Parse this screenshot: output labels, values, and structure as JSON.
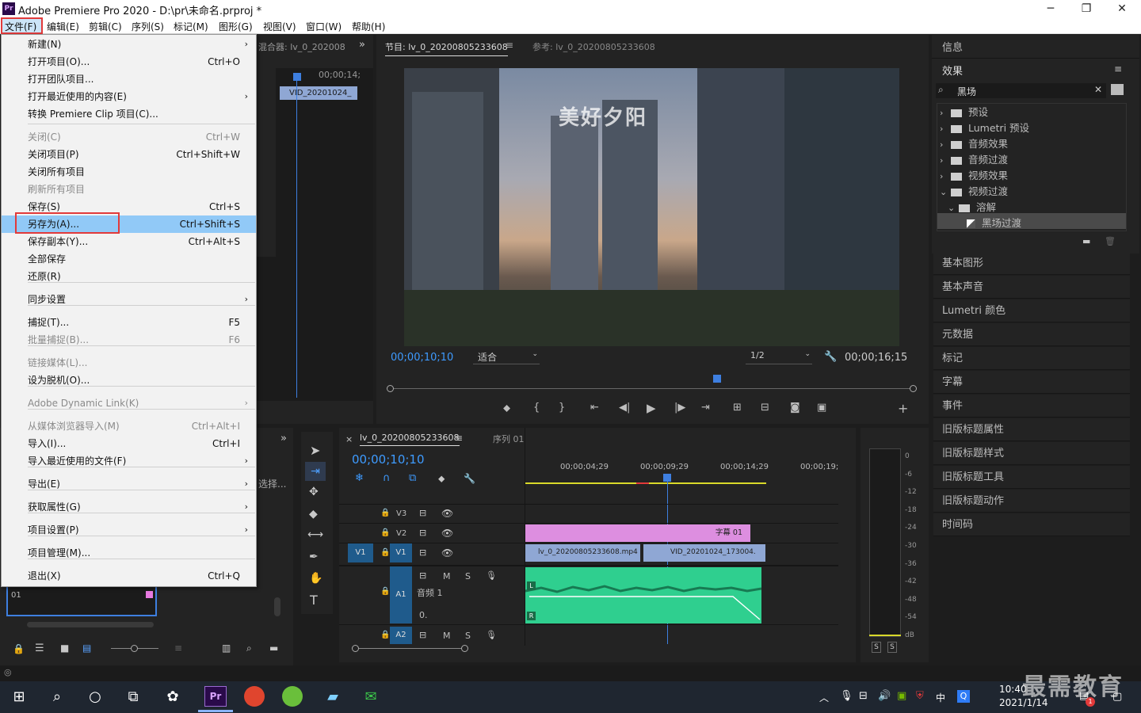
{
  "app": {
    "title": "Adobe Premiere Pro 2020 - D:\\pr\\未命名.prproj *",
    "icon_label": "Pr",
    "minimize": "─",
    "maximize": "❐",
    "close": "✕"
  },
  "menubar": [
    "文件(F)",
    "编辑(E)",
    "剪辑(C)",
    "序列(S)",
    "标记(M)",
    "图形(G)",
    "视图(V)",
    "窗口(W)",
    "帮助(H)"
  ],
  "file_menu": [
    {
      "label": "新建(N)",
      "shortcut": "",
      "arrow": "›",
      "disabled": false
    },
    {
      "label": "打开项目(O)...",
      "shortcut": "Ctrl+O",
      "arrow": "",
      "disabled": false
    },
    {
      "label": "打开团队项目...",
      "shortcut": "",
      "arrow": "",
      "disabled": false
    },
    {
      "label": "打开最近使用的内容(E)",
      "shortcut": "",
      "arrow": "›",
      "disabled": false
    },
    {
      "label": "转换 Premiere Clip 项目(C)...",
      "shortcut": "",
      "arrow": "",
      "disabled": false
    },
    {
      "label": "关闭(C)",
      "shortcut": "Ctrl+W",
      "arrow": "",
      "disabled": true
    },
    {
      "label": "关闭项目(P)",
      "shortcut": "Ctrl+Shift+W",
      "arrow": "",
      "disabled": false
    },
    {
      "label": "关闭所有项目",
      "shortcut": "",
      "arrow": "",
      "disabled": false
    },
    {
      "label": "刷新所有项目",
      "shortcut": "",
      "arrow": "",
      "disabled": true
    },
    {
      "label": "保存(S)",
      "shortcut": "Ctrl+S",
      "arrow": "",
      "disabled": false
    },
    {
      "label": "另存为(A)...",
      "shortcut": "Ctrl+Shift+S",
      "arrow": "",
      "disabled": false
    },
    {
      "label": "保存副本(Y)...",
      "shortcut": "Ctrl+Alt+S",
      "arrow": "",
      "disabled": false
    },
    {
      "label": "全部保存",
      "shortcut": "",
      "arrow": "",
      "disabled": false
    },
    {
      "label": "还原(R)",
      "shortcut": "",
      "arrow": "",
      "disabled": false
    },
    {
      "label": "同步设置",
      "shortcut": "",
      "arrow": "›",
      "disabled": false
    },
    {
      "label": "捕捉(T)...",
      "shortcut": "F5",
      "arrow": "",
      "disabled": false
    },
    {
      "label": "批量捕捉(B)...",
      "shortcut": "F6",
      "arrow": "",
      "disabled": true
    },
    {
      "label": "链接媒体(L)...",
      "shortcut": "",
      "arrow": "",
      "disabled": true
    },
    {
      "label": "设为脱机(O)...",
      "shortcut": "",
      "arrow": "",
      "disabled": false
    },
    {
      "label": "Adobe Dynamic Link(K)",
      "shortcut": "",
      "arrow": "›",
      "disabled": true
    },
    {
      "label": "从媒体浏览器导入(M)",
      "shortcut": "Ctrl+Alt+I",
      "arrow": "",
      "disabled": true
    },
    {
      "label": "导入(I)...",
      "shortcut": "Ctrl+I",
      "arrow": "",
      "disabled": false
    },
    {
      "label": "导入最近使用的文件(F)",
      "shortcut": "",
      "arrow": "›",
      "disabled": false
    },
    {
      "label": "导出(E)",
      "shortcut": "",
      "arrow": "›",
      "disabled": false
    },
    {
      "label": "获取属性(G)",
      "shortcut": "",
      "arrow": "›",
      "disabled": false
    },
    {
      "label": "项目设置(P)",
      "shortcut": "",
      "arrow": "›",
      "disabled": false
    },
    {
      "label": "项目管理(M)...",
      "shortcut": "",
      "arrow": "",
      "disabled": false
    },
    {
      "label": "退出(X)",
      "shortcut": "Ctrl+Q",
      "arrow": "",
      "disabled": false
    }
  ],
  "source_panel": {
    "tab": "混合器: lv_0_202008",
    "timecode": "00;00;14;",
    "clip": "VID_20201024_",
    "more": "»"
  },
  "program": {
    "tab": "节目: lv_0_20200805233608",
    "ref_tab": "参考: lv_0_20200805233608",
    "timecode_left": "00;00;10;10",
    "fit": "适合",
    "quality": "1/2",
    "timecode_right": "00;00;16;15",
    "caption": "美好夕阳"
  },
  "effects": {
    "info_tab": "信息",
    "tab": "效果",
    "search": "黑场",
    "tree": [
      {
        "label": "预设",
        "level": 0,
        "open": false
      },
      {
        "label": "Lumetri 预设",
        "level": 0,
        "open": false
      },
      {
        "label": "音频效果",
        "level": 0,
        "open": false
      },
      {
        "label": "音频过渡",
        "level": 0,
        "open": false
      },
      {
        "label": "视频效果",
        "level": 0,
        "open": false
      },
      {
        "label": "视频过渡",
        "level": 0,
        "open": true
      },
      {
        "label": "溶解",
        "level": 1,
        "open": true
      },
      {
        "label": "黑场过渡",
        "level": 2,
        "open": false
      }
    ]
  },
  "right_items": [
    "基本图形",
    "基本声音",
    "Lumetri 颜色",
    "元数据",
    "标记",
    "字幕",
    "事件",
    "旧版标题属性",
    "旧版标题样式",
    "旧版标题工具",
    "旧版标题动作",
    "时间码"
  ],
  "timeline": {
    "close": "×",
    "tab": "lv_0_20200805233608",
    "tab2": "序列 01",
    "timecode": "00;00;10;10",
    "ruler": [
      "00;00;04;29",
      "00;00;09;29",
      "00;00;14;29",
      "00;00;19;"
    ],
    "tracks": [
      "V3",
      "V2",
      "V1",
      "A1",
      "A2"
    ],
    "src_v1": "V1",
    "a1_name": "音频 1",
    "clip_v2": "字幕 01",
    "clip_v1a": "lv_0_20200805233608.mp4",
    "clip_v1b": "VID_20201024_173004.",
    "M": "M",
    "S": "S",
    "L": "L",
    "R": "R",
    "zero": "0."
  },
  "project": {
    "search": "选择...",
    "item": "序列 01",
    "small_label": "01"
  },
  "meter": {
    "scale": [
      "0",
      "-6",
      "-12",
      "-18",
      "-24",
      "-30",
      "-36",
      "-42",
      "-48",
      "-54",
      "dB"
    ],
    "solo_left": "S",
    "solo_right": "S"
  },
  "taskbar": {
    "time": "10:40",
    "date": "2021/1/14",
    "ime": "中",
    "badge": "1",
    "watermark": "最需教育"
  }
}
